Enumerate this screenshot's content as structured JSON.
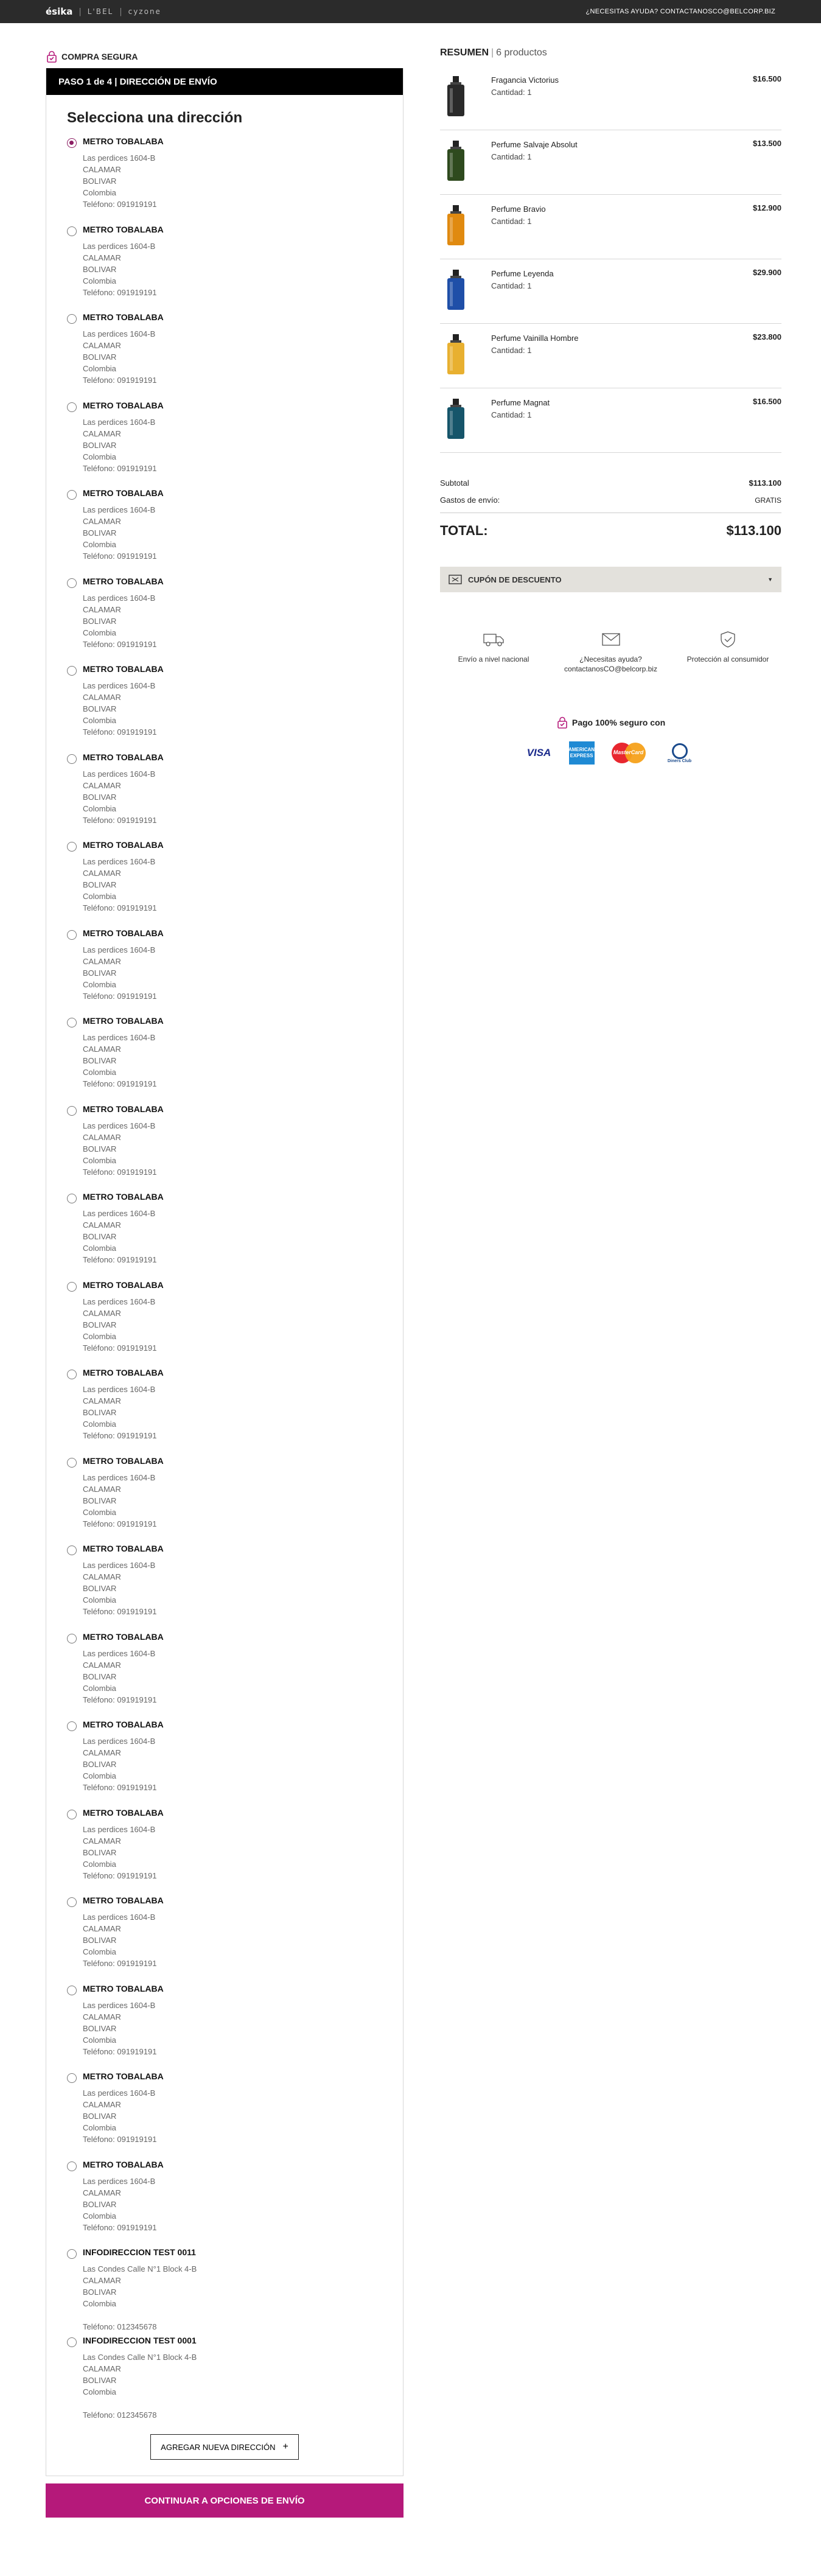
{
  "topbar": {
    "brands": [
      "ésika",
      "L'BEL",
      "cyzone"
    ],
    "help": "¿NECESITAS AYUDA? CONTACTANOSCO@BELCORP.BIZ"
  },
  "secure_label": "COMPRA SEGURA",
  "step": "PASO 1 de 4 | DIRECCIÓN DE ENVÍO",
  "select_title": "Selecciona una dirección",
  "addresses": [
    {
      "name": "METRO TOBALABA",
      "lines": [
        "Las perdices 1604-B",
        "CALAMAR",
        "BOLIVAR",
        "Colombia"
      ],
      "phone": "Teléfono: 091919191",
      "selected": true
    },
    {
      "name": "METRO TOBALABA",
      "lines": [
        "Las perdices 1604-B",
        "CALAMAR",
        "BOLIVAR",
        "Colombia"
      ],
      "phone": "Teléfono: 091919191"
    },
    {
      "name": "METRO TOBALABA",
      "lines": [
        "Las perdices 1604-B",
        "CALAMAR",
        "BOLIVAR",
        "Colombia"
      ],
      "phone": "Teléfono: 091919191"
    },
    {
      "name": "METRO TOBALABA",
      "lines": [
        "Las perdices 1604-B",
        "CALAMAR",
        "BOLIVAR",
        "Colombia"
      ],
      "phone": "Teléfono: 091919191"
    },
    {
      "name": "METRO TOBALABA",
      "lines": [
        "Las perdices 1604-B",
        "CALAMAR",
        "BOLIVAR",
        "Colombia"
      ],
      "phone": "Teléfono: 091919191"
    },
    {
      "name": "METRO TOBALABA",
      "lines": [
        "Las perdices 1604-B",
        "CALAMAR",
        "BOLIVAR",
        "Colombia"
      ],
      "phone": "Teléfono: 091919191"
    },
    {
      "name": "METRO TOBALABA",
      "lines": [
        "Las perdices 1604-B",
        "CALAMAR",
        "BOLIVAR",
        "Colombia"
      ],
      "phone": "Teléfono: 091919191"
    },
    {
      "name": "METRO TOBALABA",
      "lines": [
        "Las perdices 1604-B",
        "CALAMAR",
        "BOLIVAR",
        "Colombia"
      ],
      "phone": "Teléfono: 091919191"
    },
    {
      "name": "METRO TOBALABA",
      "lines": [
        "Las perdices 1604-B",
        "CALAMAR",
        "BOLIVAR",
        "Colombia"
      ],
      "phone": "Teléfono: 091919191"
    },
    {
      "name": "METRO TOBALABA",
      "lines": [
        "Las perdices 1604-B",
        "CALAMAR",
        "BOLIVAR",
        "Colombia"
      ],
      "phone": "Teléfono: 091919191"
    },
    {
      "name": "METRO TOBALABA",
      "lines": [
        "Las perdices 1604-B",
        "CALAMAR",
        "BOLIVAR",
        "Colombia"
      ],
      "phone": "Teléfono: 091919191"
    },
    {
      "name": "METRO TOBALABA",
      "lines": [
        "Las perdices 1604-B",
        "CALAMAR",
        "BOLIVAR",
        "Colombia"
      ],
      "phone": "Teléfono: 091919191"
    },
    {
      "name": "METRO TOBALABA",
      "lines": [
        "Las perdices 1604-B",
        "CALAMAR",
        "BOLIVAR",
        "Colombia"
      ],
      "phone": "Teléfono: 091919191"
    },
    {
      "name": "METRO TOBALABA",
      "lines": [
        "Las perdices 1604-B",
        "CALAMAR",
        "BOLIVAR",
        "Colombia"
      ],
      "phone": "Teléfono: 091919191"
    },
    {
      "name": "METRO TOBALABA",
      "lines": [
        "Las perdices 1604-B",
        "CALAMAR",
        "BOLIVAR",
        "Colombia"
      ],
      "phone": "Teléfono: 091919191"
    },
    {
      "name": "METRO TOBALABA",
      "lines": [
        "Las perdices 1604-B",
        "CALAMAR",
        "BOLIVAR",
        "Colombia"
      ],
      "phone": "Teléfono: 091919191"
    },
    {
      "name": "METRO TOBALABA",
      "lines": [
        "Las perdices 1604-B",
        "CALAMAR",
        "BOLIVAR",
        "Colombia"
      ],
      "phone": "Teléfono: 091919191"
    },
    {
      "name": "METRO TOBALABA",
      "lines": [
        "Las perdices 1604-B",
        "CALAMAR",
        "BOLIVAR",
        "Colombia"
      ],
      "phone": "Teléfono: 091919191"
    },
    {
      "name": "METRO TOBALABA",
      "lines": [
        "Las perdices 1604-B",
        "CALAMAR",
        "BOLIVAR",
        "Colombia"
      ],
      "phone": "Teléfono: 091919191"
    },
    {
      "name": "METRO TOBALABA",
      "lines": [
        "Las perdices 1604-B",
        "CALAMAR",
        "BOLIVAR",
        "Colombia"
      ],
      "phone": "Teléfono: 091919191"
    },
    {
      "name": "METRO TOBALABA",
      "lines": [
        "Las perdices 1604-B",
        "CALAMAR",
        "BOLIVAR",
        "Colombia"
      ],
      "phone": "Teléfono: 091919191"
    },
    {
      "name": "METRO TOBALABA",
      "lines": [
        "Las perdices 1604-B",
        "CALAMAR",
        "BOLIVAR",
        "Colombia"
      ],
      "phone": "Teléfono: 091919191"
    },
    {
      "name": "METRO TOBALABA",
      "lines": [
        "Las perdices 1604-B",
        "CALAMAR",
        "BOLIVAR",
        "Colombia"
      ],
      "phone": "Teléfono: 091919191"
    },
    {
      "name": "METRO TOBALABA",
      "lines": [
        "Las perdices 1604-B",
        "CALAMAR",
        "BOLIVAR",
        "Colombia"
      ],
      "phone": "Teléfono: 091919191"
    },
    {
      "name": "INFODIRECCION TEST 0011",
      "lines": [
        "Las Condes Calle N°1 Block 4-B",
        "CALAMAR",
        "BOLIVAR",
        "Colombia"
      ],
      "phone": "Teléfono: 012345678",
      "blank": true
    },
    {
      "name": "INFODIRECCION TEST 0001",
      "lines": [
        "Las Condes Calle N°1 Block 4-B",
        "CALAMAR",
        "BOLIVAR",
        "Colombia"
      ],
      "phone": "Teléfono: 012345678",
      "blank": true
    }
  ],
  "add_address": "AGREGAR NUEVA DIRECCIÓN",
  "continue_label": "CONTINUAR A OPCIONES DE ENVÍO",
  "summary": {
    "label": "RESUMEN",
    "count": "6 productos",
    "items": [
      {
        "name": "Fragancia Victorius",
        "qty": "Cantidad: 1",
        "price": "$16.500",
        "color": "#2a2a2a"
      },
      {
        "name": "Perfume Salvaje Absolut",
        "qty": "Cantidad: 1",
        "price": "$13.500",
        "color": "#2e4a1e"
      },
      {
        "name": "Perfume Bravio",
        "qty": "Cantidad: 1",
        "price": "$12.900",
        "color": "#e08a10"
      },
      {
        "name": "Perfume Leyenda",
        "qty": "Cantidad: 1",
        "price": "$29.900",
        "color": "#1f4fa8"
      },
      {
        "name": "Perfume Vainilla Hombre",
        "qty": "Cantidad: 1",
        "price": "$23.800",
        "color": "#e8b030"
      },
      {
        "name": "Perfume Magnat",
        "qty": "Cantidad: 1",
        "price": "$16.500",
        "color": "#16556a"
      }
    ],
    "subtotal_label": "Subtotal",
    "subtotal": "$113.100",
    "shipping_label": "Gastos de envío:",
    "shipping": "GRATIS",
    "total_label": "TOTAL:",
    "total": "$113.100"
  },
  "coupon_label": "CUPÓN DE DESCUENTO",
  "benefits": {
    "shipping": "Envío a nivel nacional",
    "help_title": "¿Necesitas ayuda?",
    "help_email": "contactanosCO@belcorp.biz",
    "protection": "Protección al consumidor"
  },
  "payment": {
    "title": "Pago 100% seguro con",
    "visa": "VISA",
    "amex": "AMERICAN EXPRESS",
    "mastercard": "MasterCard",
    "diners": "Diners Club"
  },
  "colors": {
    "accent": "#b5197a",
    "radio": "#8c1e63",
    "coupon_bg": "#e3e1dc"
  }
}
